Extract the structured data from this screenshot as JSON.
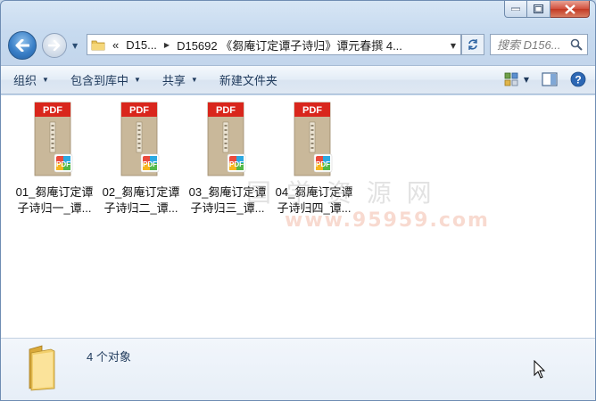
{
  "window": {
    "caption": {
      "minimize": "minimize",
      "maximize": "maximize",
      "close": "close"
    }
  },
  "address": {
    "prefix": "«",
    "crumbs": [
      "D15...",
      "D15692 《芻庵订定谭子诗归》谭元春撰 4..."
    ]
  },
  "search": {
    "placeholder": "搜索 D156..."
  },
  "toolbar": {
    "organize": "组织",
    "include_in_library": "包含到库中",
    "share": "共享",
    "new_folder": "新建文件夹"
  },
  "files": [
    {
      "name": "01_芻庵订定谭子诗归一_谭...",
      "badge": "PDF"
    },
    {
      "name": "02_芻庵订定谭子诗归二_谭...",
      "badge": "PDF"
    },
    {
      "name": "03_芻庵订定谭子诗归三_谭...",
      "badge": "PDF"
    },
    {
      "name": "04_芻庵订定谭子诗归四_谭...",
      "badge": "PDF"
    }
  ],
  "watermark": {
    "line1": "国 学 资 源 网",
    "line2": "www.95959.com"
  },
  "status": {
    "count": "4 个对象"
  },
  "colors": {
    "pdf_red": "#d9261c",
    "accent": "#3a7fc7",
    "book_cover": "#c9b89a"
  }
}
